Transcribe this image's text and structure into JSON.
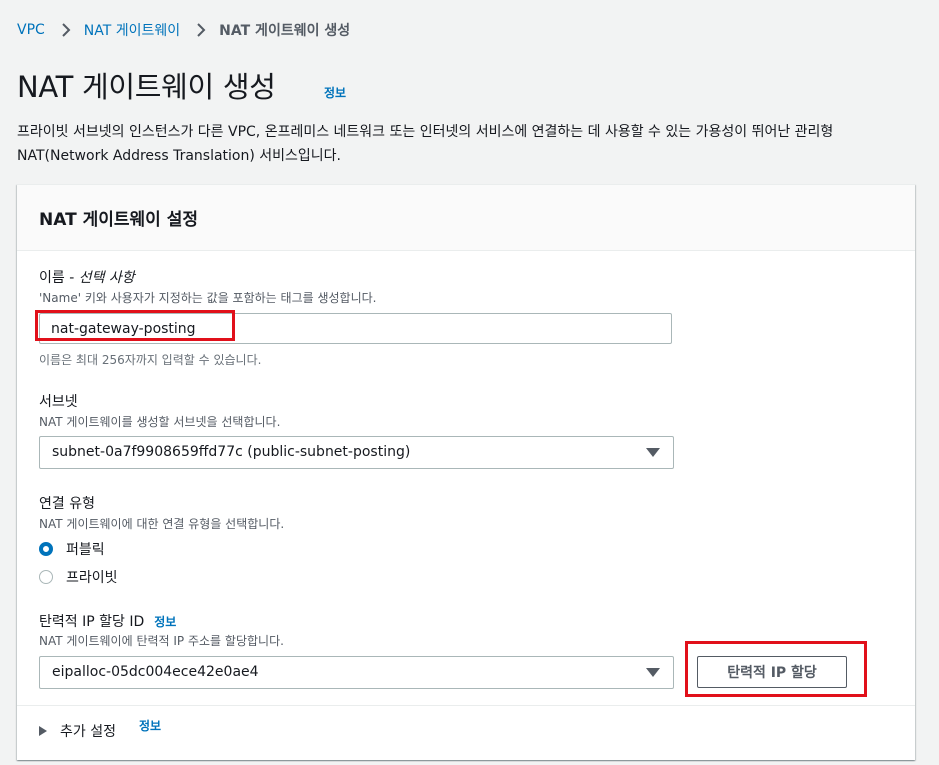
{
  "breadcrumb": {
    "items": [
      "VPC",
      "NAT 게이트웨이"
    ],
    "current": "NAT 게이트웨이 생성"
  },
  "page": {
    "title": "NAT 게이트웨이 생성",
    "info": "정보",
    "description": "프라이빗 서브넷의 인스턴스가 다른 VPC, 온프레미스 네트워크 또는 인터넷의 서비스에 연결하는 데 사용할 수 있는 가용성이 뛰어난 관리형 NAT(Network Address Translation) 서비스입니다."
  },
  "panel": {
    "title": "NAT 게이트웨이 설정",
    "name_field": {
      "label": "이름 - ",
      "label_optional": "선택 사항",
      "description": "'Name' 키와 사용자가 지정하는 값을 포함하는 태그를 생성합니다.",
      "value": "nat-gateway-posting",
      "hint": "이름은 최대 256자까지 입력할 수 있습니다."
    },
    "subnet_field": {
      "label": "서브넷",
      "description": "NAT 게이트웨이를 생성할 서브넷을 선택합니다.",
      "value": "subnet-0a7f9908659ffd77c (public-subnet-posting)"
    },
    "connectivity_field": {
      "label": "연결 유형",
      "description": "NAT 게이트웨이에 대한 연결 유형을 선택합니다.",
      "options": [
        "퍼블릭",
        "프라이빗"
      ],
      "selected": "퍼블릭"
    },
    "eip_field": {
      "label": "탄력적 IP 할당 ID",
      "info": "정보",
      "description": "NAT 게이트웨이에 탄력적 IP 주소를 할당합니다.",
      "value": "eipalloc-05dc004ece42e0ae4",
      "button": "탄력적 IP 할당"
    },
    "additional": {
      "label": "추가 설정",
      "info": "정보"
    }
  },
  "colors": {
    "link": "#0073bb",
    "highlight": "#e1101a",
    "background": "#f2f3f3"
  }
}
